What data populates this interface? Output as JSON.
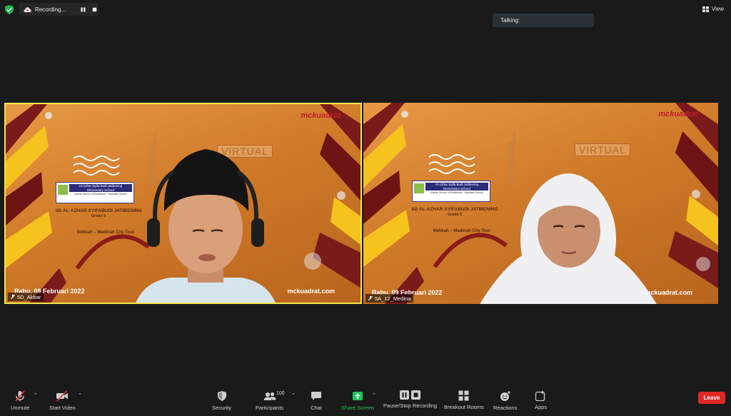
{
  "topbar": {
    "recording_label": "Recording...",
    "view_label": "View",
    "talking_label": "Talking:"
  },
  "videos": [
    {
      "participant_name": "5D_Akbar",
      "brand": "mckuadrat",
      "virtual_label": "VIRTUAL",
      "school_name": "Al-Azhar Syifa Budi Jatibening",
      "school_sub": "Elementary School",
      "school_caption": "Islamic School of Excellence · Mountain School",
      "class_line": "SD AL-AZHAR SYIFABUDI JATIBENING",
      "grade": "Grade 5",
      "tour": "Mekkah – Madinah City Tour",
      "date": "Rabu, 09 Februari 2022",
      "site": "mckuadrat.com",
      "active_speaker": true
    },
    {
      "participant_name": "5A_12_Medina",
      "brand": "mckuadrat",
      "virtual_label": "VIRTUAL",
      "school_name": "Al-Azhar Syifa Budi Jatibening",
      "school_sub": "Elementary School",
      "school_caption": "Islamic School of Excellence · Mountain School",
      "class_line": "SD AL-AZHAR SYIFABUDI JATIBENING",
      "grade": "Grade 5",
      "tour": "Mekkah – Madinah City Tour",
      "date": "Rabu, 09 Februari 2022",
      "site": "mckuadrat.com",
      "active_speaker": false
    }
  ],
  "toolbar": {
    "unmute": "Unmute",
    "start_video": "Start Video",
    "security": "Security",
    "participants": "Participants",
    "participants_count": "100",
    "chat": "Chat",
    "share_screen": "Share Screen",
    "recording": "Pause/Stop Recording",
    "breakout": "Breakout Rooms",
    "reactions": "Reactions",
    "apps": "Apps",
    "leave": "Leave"
  },
  "colors": {
    "active_speaker_border": "#f2e84a",
    "share_green": "#20c55e",
    "leave_red": "#e02828"
  }
}
